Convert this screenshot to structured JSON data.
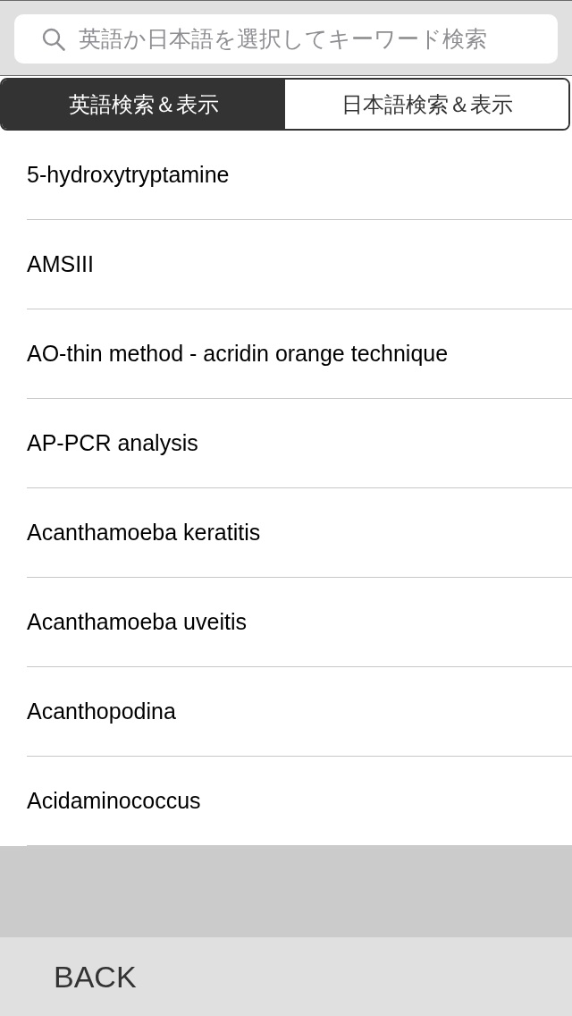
{
  "search": {
    "placeholder": "英語か日本語を選択してキーワード検索"
  },
  "tabs": [
    {
      "label": "英語検索＆表示",
      "selected": true
    },
    {
      "label": "日本語検索＆表示",
      "selected": false
    }
  ],
  "results": [
    "5-hydroxytryptamine",
    "AMSIII",
    "AO-thin method - acridin orange technique",
    "AP-PCR analysis",
    "Acanthamoeba keratitis",
    "Acanthamoeba uveitis",
    "Acanthopodina",
    "Acidaminococcus"
  ],
  "footer": {
    "back_button": "BACK"
  }
}
